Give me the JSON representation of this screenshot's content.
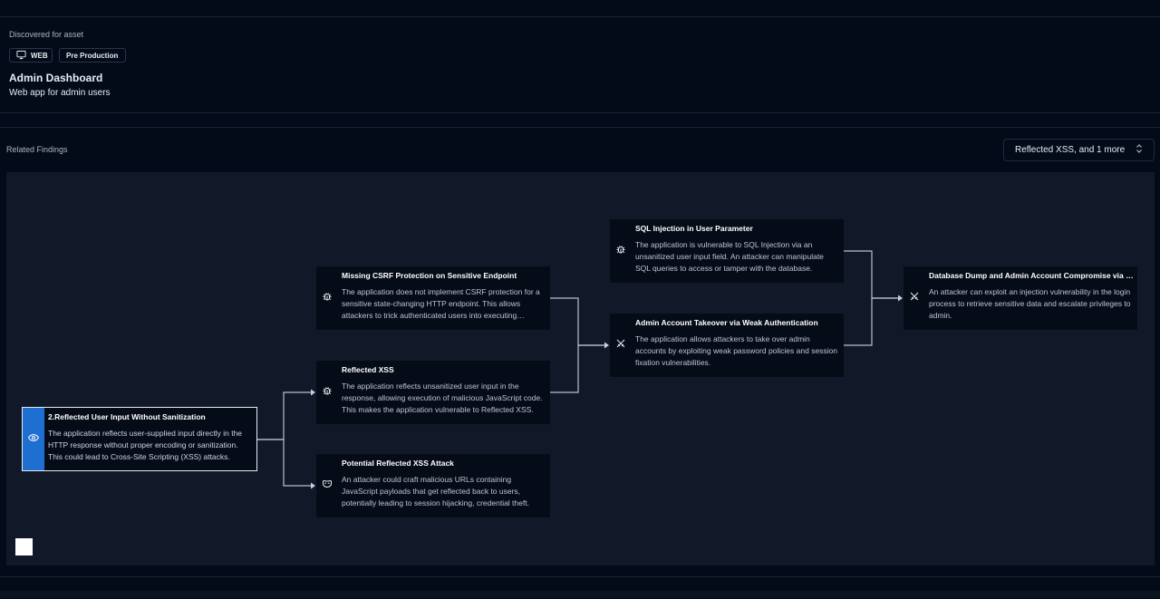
{
  "asset": {
    "caption": "Discovered for asset",
    "chips": [
      {
        "label": "WEB",
        "icon": "monitor-icon"
      },
      {
        "label": "Pre Production"
      }
    ],
    "title": "Admin Dashboard",
    "subtitle": "Web app for admin users"
  },
  "findings": {
    "label": "Related Findings",
    "filter_value": "Reflected XSS, and 1 more"
  },
  "graph": {
    "nodes": [
      {
        "id": "root",
        "icon": "eye-icon",
        "title": "2.Reflected User Input Without Sanitization",
        "description": "The application reflects user-supplied input directly in the HTTP response without proper encoding or sanitization. This could lead to Cross-Site Scripting (XSS) attacks.",
        "selected": true
      },
      {
        "id": "csrf",
        "icon": "bug-icon",
        "title": "Missing CSRF Protection on Sensitive Endpoint",
        "description": "The application does not implement CSRF protection for a sensitive state-changing HTTP endpoint. This allows attackers to trick authenticated users into executing unwanted actions."
      },
      {
        "id": "xss",
        "icon": "bug-icon",
        "title": "Reflected XSS",
        "description": "The application reflects unsanitized user input in the response, allowing execution of malicious JavaScript code. This makes the application vulnerable to Reflected XSS."
      },
      {
        "id": "potxss",
        "icon": "mask-icon",
        "title": "Potential Reflected XSS Attack",
        "description": "An attacker could craft malicious URLs containing JavaScript payloads that get reflected back to users, potentially leading to session hijacking, credential theft."
      },
      {
        "id": "sqli",
        "icon": "bug-icon",
        "title": "SQL Injection in User Parameter",
        "description": "The application is vulnerable to SQL Injection via an unsanitized user input field. An attacker can manipulate SQL queries to access or tamper with the database."
      },
      {
        "id": "takeover",
        "icon": "swords-icon",
        "title": "Admin Account Takeover via Weak Authentication",
        "description": "The application allows attackers to take over admin accounts by exploiting weak password policies and session fixation vulnerabilities."
      },
      {
        "id": "dbdump",
        "icon": "swords-icon",
        "title": "Database Dump and Admin Account Compromise via Injection",
        "description": "An attacker can exploit an injection vulnerability in the login process to retrieve sensitive data and escalate privileges to admin."
      }
    ]
  }
}
